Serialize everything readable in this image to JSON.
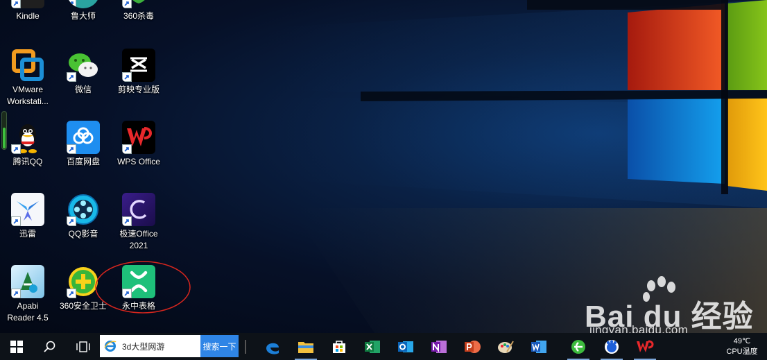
{
  "desktop": {
    "icons": [
      {
        "label": "Kindle",
        "icon": "kindle-icon"
      },
      {
        "label": "鲁大师",
        "icon": "ludashi-icon"
      },
      {
        "label": "360杀毒",
        "icon": "360-antivirus-icon"
      },
      {
        "label": "VMware\nWorkstati...",
        "icon": "vmware-icon"
      },
      {
        "label": "微信",
        "icon": "wechat-icon"
      },
      {
        "label": "剪映专业版",
        "icon": "capcut-icon"
      },
      {
        "label": "腾讯QQ",
        "icon": "qq-icon"
      },
      {
        "label": "百度网盘",
        "icon": "baidu-netdisk-icon"
      },
      {
        "label": "WPS Office",
        "icon": "wps-icon"
      },
      {
        "label": "迅雷",
        "icon": "xunlei-icon"
      },
      {
        "label": "QQ影音",
        "icon": "qq-player-icon"
      },
      {
        "label": "极速Office\n2021",
        "icon": "jisu-office-icon"
      },
      {
        "label": "Apabi\nReader 4.5",
        "icon": "apabi-reader-icon"
      },
      {
        "label": "360安全卫士",
        "icon": "360-security-icon"
      },
      {
        "label": "永中表格",
        "icon": "yozo-sheet-icon"
      }
    ]
  },
  "watermark": {
    "brand": "Bai du 经验",
    "url": "jingyan.baidu.com"
  },
  "taskbar": {
    "search_text": "3d大型网游",
    "search_button": "搜索一下",
    "apps": [
      "edge-icon",
      "file-explorer-icon",
      "store-icon",
      "excel-icon",
      "outlook-icon",
      "onenote-icon",
      "powerpoint-icon",
      "paint-icon",
      "word-icon",
      "360-browser-icon",
      "baidu-netdisk-icon",
      "wps-icon"
    ],
    "tray": {
      "temperature": "49℃",
      "temperature_label": "CPU温度"
    }
  }
}
